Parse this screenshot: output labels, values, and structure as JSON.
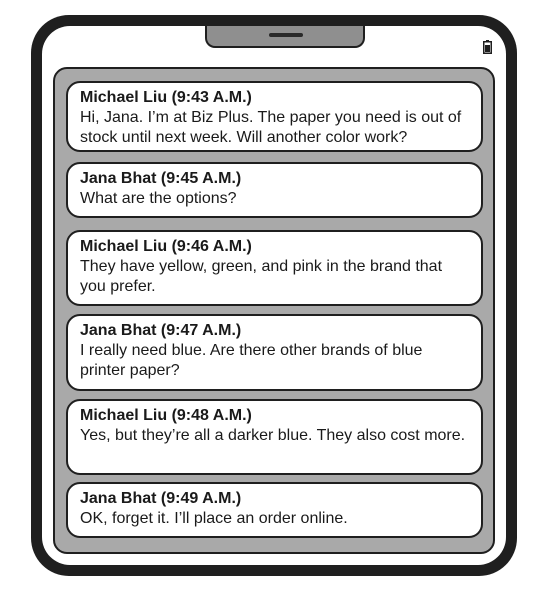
{
  "messages": [
    {
      "sender": "Michael Liu (9:43 A.M.)",
      "text": "Hi, Jana. I’m at Biz Plus. The paper you need is out of stock until next week. Will another color work?"
    },
    {
      "sender": "Jana Bhat (9:45 A.M.)",
      "text": "What are the options?"
    },
    {
      "sender": "Michael Liu (9:46 A.M.)",
      "text": "They have yellow, green, and pink in the brand that you prefer."
    },
    {
      "sender": "Jana Bhat (9:47 A.M.)",
      "text": "I really need blue. Are there other brands of blue printer paper?"
    },
    {
      "sender": "Michael Liu (9:48 A.M.)",
      "text": "Yes, but they’re all a darker blue. They also cost more."
    },
    {
      "sender": "Jana Bhat (9:49 A.M.)",
      "text": "OK, forget it. I’ll place an order online."
    }
  ],
  "status_icons": {
    "battery": "battery-icon"
  },
  "colors": {
    "frame": "#1f1f1f",
    "screen": "#a9a9a9",
    "bubble": "#ffffff",
    "notch": "#8f8f8f"
  }
}
